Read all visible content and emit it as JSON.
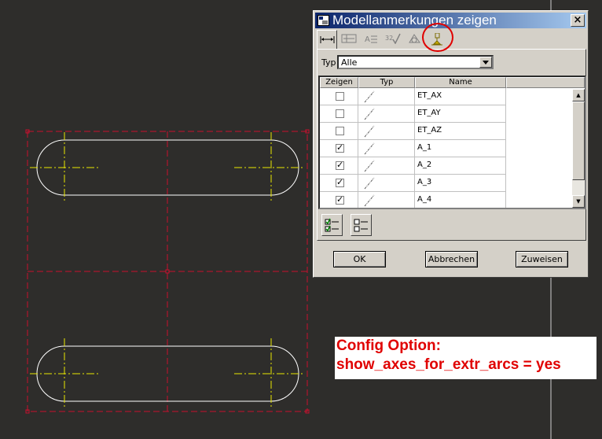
{
  "dialog": {
    "title": "Modellanmerkungen zeigen",
    "close_label": "×",
    "tabs": [
      "dimension-icon",
      "tolerance-icon",
      "note-icon",
      "symbol-icon",
      "surface-finish-icon",
      "datum-axis-icon"
    ],
    "typ_label": "Typ",
    "typ_value": "Alle",
    "columns": {
      "show": "Zeigen",
      "type": "Typ",
      "name": "Name"
    },
    "rows": [
      {
        "name": "ET_AX",
        "checked": false
      },
      {
        "name": "ET_AY",
        "checked": false
      },
      {
        "name": "ET_AZ",
        "checked": false
      },
      {
        "name": "A_1",
        "checked": true
      },
      {
        "name": "A_2",
        "checked": true
      },
      {
        "name": "A_3",
        "checked": true
      },
      {
        "name": "A_4",
        "checked": true
      }
    ],
    "select_all_icon": "select-all-icon",
    "deselect_all_icon": "deselect-all-icon",
    "ok_label": "OK",
    "cancel_label": "Abbrechen",
    "apply_label": "Zuweisen"
  },
  "annotation": {
    "line1": "Config Option:",
    "line2": "show_axes_for_extr_arcs = yes"
  },
  "colors": {
    "background": "#2e2d2b",
    "geometry": "#ffffff",
    "axis": "#e8e800",
    "datum": "#c8102e",
    "highlight": "#e00000",
    "title_bar": "#0a246a"
  }
}
